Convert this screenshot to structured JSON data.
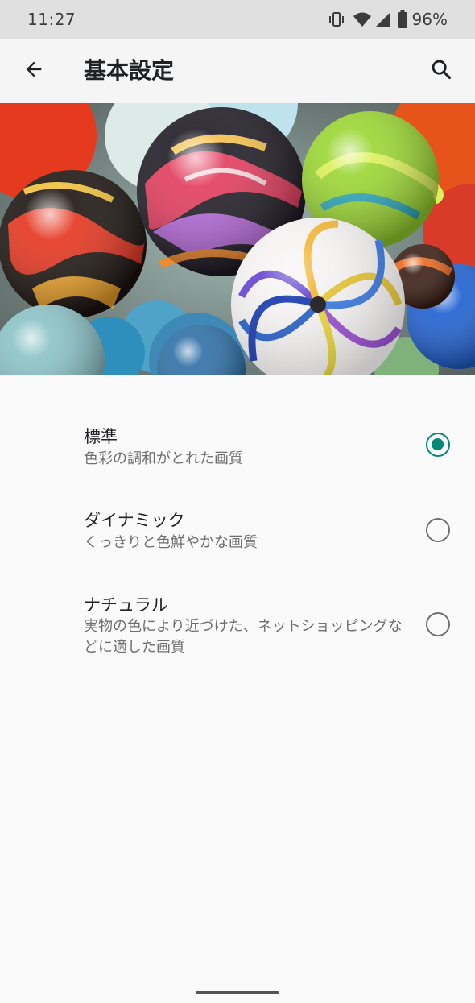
{
  "status_bar": {
    "time": "11:27",
    "battery_percent": "96%",
    "icons": [
      "vibrate-icon",
      "wifi-icon",
      "signal-icon",
      "battery-icon"
    ]
  },
  "app_bar": {
    "title": "基本設定",
    "back_icon": "arrow-left-icon",
    "search_icon": "search-icon"
  },
  "hero": {
    "image": "colorful-glass-marbles"
  },
  "options": [
    {
      "title": "標準",
      "description": "色彩の調和がとれた画質",
      "selected": true
    },
    {
      "title": "ダイナミック",
      "description": "くっきりと色鮮やかな画質",
      "selected": false
    },
    {
      "title": "ナチュラル",
      "description": "実物の色により近づけた、ネットショッピングなどに適した画質",
      "selected": false
    }
  ],
  "colors": {
    "accent": "#00897b",
    "status_bar_bg": "#e0e0e0",
    "app_bar_bg": "#f5f5f5",
    "background": "#fafafa"
  }
}
